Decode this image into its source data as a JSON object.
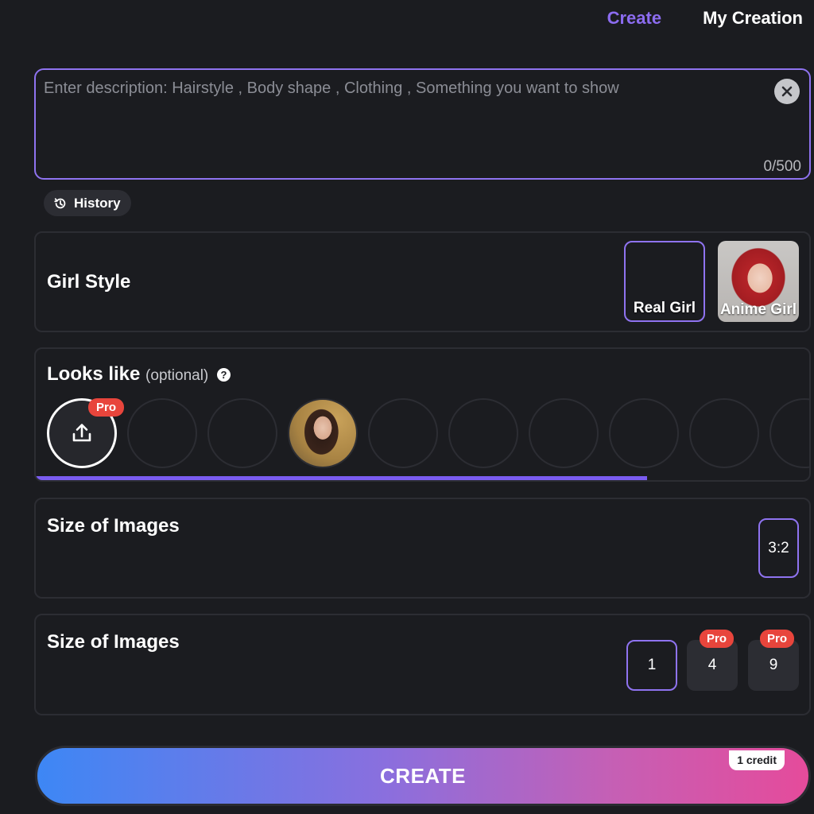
{
  "nav": {
    "create": "Create",
    "my_creation": "My Creation"
  },
  "description": {
    "placeholder": "Enter description: Hairstyle , Body shape , Clothing , Something you want to show",
    "value": "",
    "count": "0/500"
  },
  "history": {
    "label": "History"
  },
  "girl_style": {
    "title": "Girl Style",
    "options": [
      {
        "label": "Real Girl",
        "selected": true
      },
      {
        "label": "Anime Girl",
        "selected": false
      }
    ]
  },
  "looks_like": {
    "title": "Looks like",
    "optional": "(optional)",
    "help": "?",
    "pro_badge": "Pro",
    "scroll_position": 0.79
  },
  "size_ratio": {
    "title": "Size of Images",
    "options": [
      {
        "label": "3:2",
        "selected": true
      }
    ]
  },
  "image_count": {
    "title": "Size of Images",
    "options": [
      {
        "label": "1",
        "selected": true,
        "pro": ""
      },
      {
        "label": "4",
        "selected": false,
        "pro": "Pro"
      },
      {
        "label": "9",
        "selected": false,
        "pro": "Pro"
      }
    ]
  },
  "create_button": {
    "label": "CREATE",
    "credit": "1 credit"
  },
  "colors": {
    "background": "#1b1c20",
    "accent": "#8f73f0",
    "panel_border": "#2c2d33",
    "pro_badge": "#e8453c",
    "gradient_start": "#3d87f5",
    "gradient_end": "#e54b9b"
  }
}
